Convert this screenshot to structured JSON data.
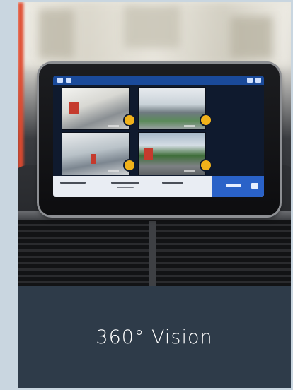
{
  "card": {
    "caption": "360° Vision"
  },
  "colors": {
    "page_background": "#c9d6e0",
    "card_background": "#2e3b49",
    "caption_text": "#ffffff",
    "screen_accent": "#2a62c8",
    "camera_badge": "#f1b21a"
  },
  "photo": {
    "subject": "car-infotainment-screen-360-camera-view"
  }
}
